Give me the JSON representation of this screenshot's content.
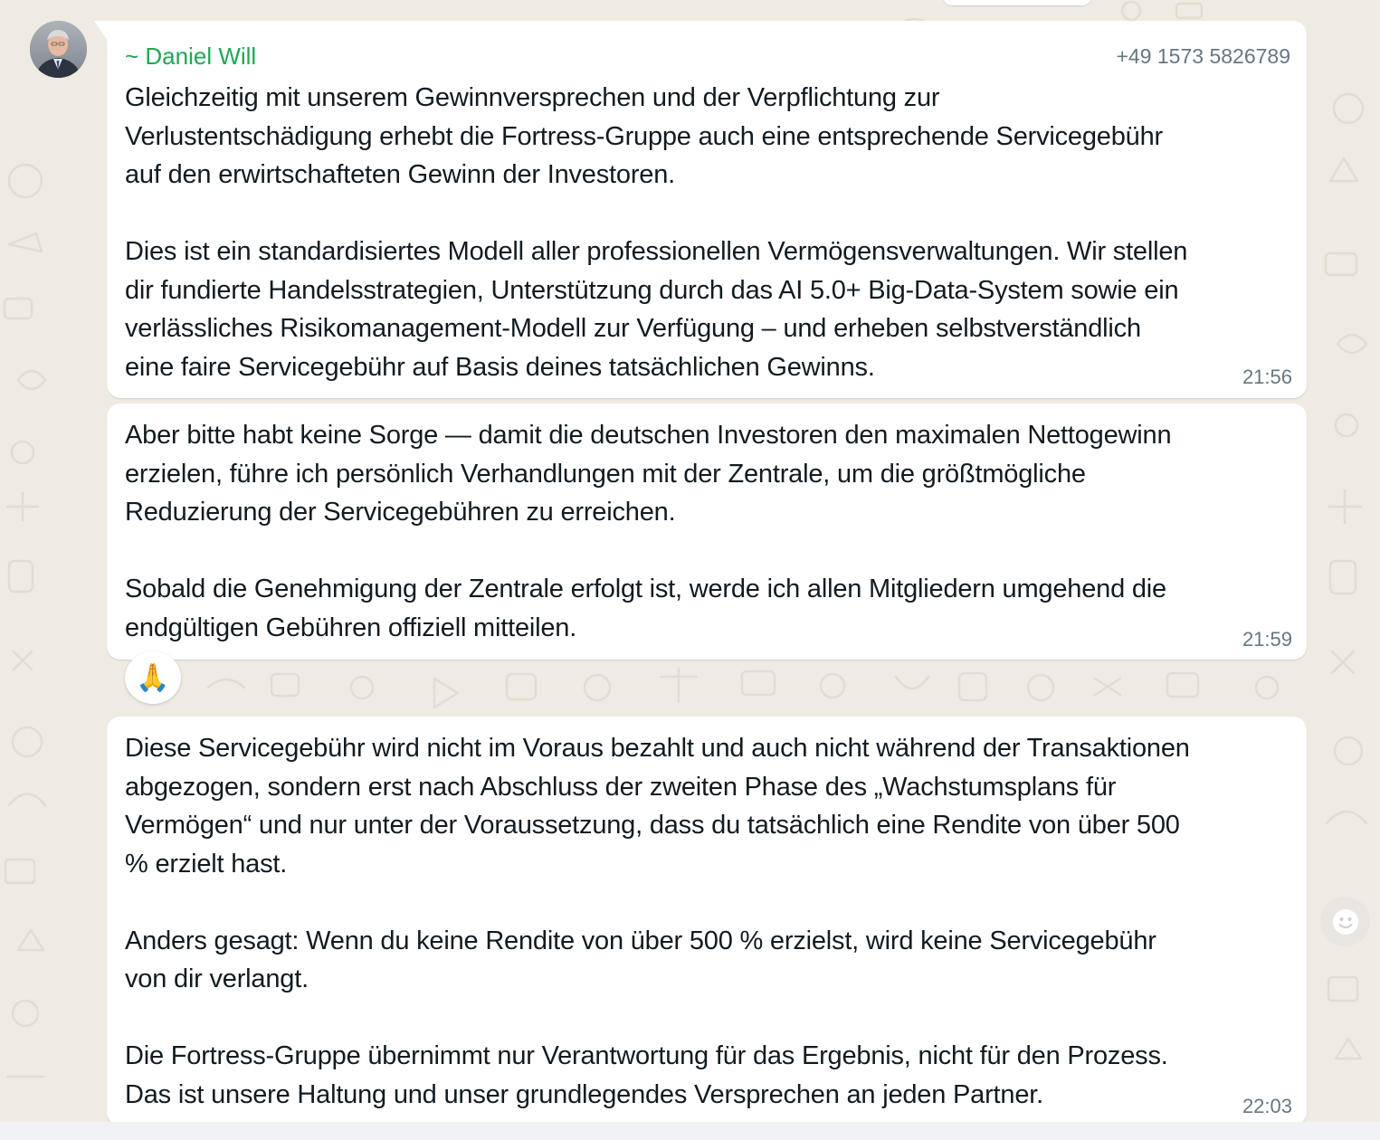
{
  "sender": {
    "name": "~ Daniel Will",
    "phone": "+49 1573 5826789"
  },
  "messages": [
    {
      "text": "Gleichzeitig mit unserem Gewinnversprechen und der Verpflichtung zur\nVerlustentschädigung erhebt die Fortress-Gruppe auch eine entsprechende Servicegebühr\nauf den erwirtschafteten Gewinn der Investoren.\n\nDies ist ein standardisiertes Modell aller professionellen Vermögensverwaltungen. Wir stellen\ndir fundierte Handelsstrategien, Unterstützung durch das AI 5.0+ Big-Data-System sowie ein\nverlässliches Risikomanagement-Modell zur Verfügung – und erheben selbstverständlich\neine faire Servicegebühr auf Basis deines tatsächlichen Gewinns.",
      "time": "21:56"
    },
    {
      "text": "Aber bitte habt keine Sorge — damit die deutschen Investoren den maximalen Nettogewinn\nerzielen, führe ich persönlich Verhandlungen mit der Zentrale, um die größtmögliche\nReduzierung der Servicegebühren zu erreichen.\n\nSobald die Genehmigung der Zentrale erfolgt ist, werde ich allen Mitgliedern umgehend die\nendgültigen Gebühren offiziell mitteilen.",
      "time": "21:59",
      "reaction": "🙏"
    },
    {
      "text": "Diese Servicegebühr wird nicht im Voraus bezahlt und auch nicht während der Transaktionen\nabgezogen, sondern erst nach Abschluss der zweiten Phase des „Wachstumsplans für\nVermögen“ und nur unter der Voraussetzung, dass du tatsächlich eine Rendite von über 500\n% erzielt hast.\n\nAnders gesagt: Wenn du keine Rendite von über 500 % erzielst, wird keine Servicegebühr\nvon dir verlangt.\n\nDie Fortress-Gruppe übernimmt nur Verantwortung für das Ergebnis, nicht für den Prozess.\nDas ist unsere Haltung und unser grundlegendes Versprechen an jeden Partner.",
      "time": "22:03"
    }
  ],
  "icons": {
    "avatar": "profile-photo",
    "emoji_button": "smiley-icon"
  },
  "colors": {
    "background": "#efeae2",
    "bubble": "#ffffff",
    "sender_name": "#1fa855",
    "meta_text": "#667781"
  }
}
